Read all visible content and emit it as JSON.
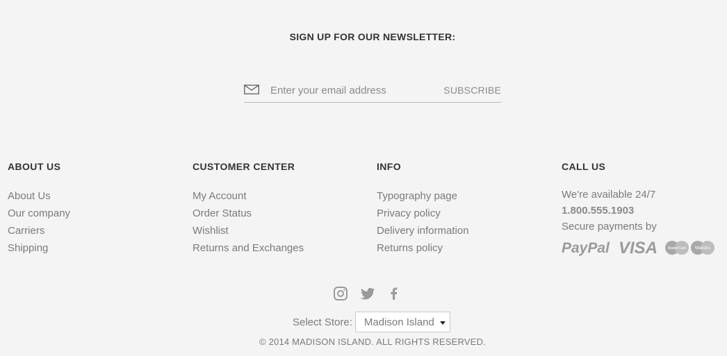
{
  "newsletter": {
    "title": "SIGN UP FOR OUR NEWSLETTER:",
    "email_placeholder": "Enter your email address",
    "subscribe_label": "SUBSCRIBE",
    "icon": "mail-icon"
  },
  "columns": {
    "about": {
      "heading": "ABOUT US",
      "links": [
        "About Us",
        "Our company",
        "Carriers",
        "Shipping"
      ]
    },
    "customer": {
      "heading": "CUSTOMER CENTER",
      "links": [
        "My Account",
        "Order Status",
        "Wishlist",
        "Returns and Exchanges"
      ]
    },
    "info": {
      "heading": "INFO",
      "links": [
        "Typography page",
        "Privacy policy",
        "Delivery information",
        "Returns policy"
      ]
    },
    "call": {
      "heading": "CALL US",
      "availability": "We're available 24/7",
      "phone": "1.800.555.1903",
      "payments_label": "Secure payments by",
      "payment_methods": [
        "PayPal",
        "VISA",
        "MasterCard",
        "Maestro"
      ]
    }
  },
  "social": [
    "instagram-icon",
    "twitter-icon",
    "facebook-icon"
  ],
  "store": {
    "label": "Select Store:",
    "selected": "Madison Island"
  },
  "copyright": "© 2014 MADISON ISLAND. ALL RIGHTS RESERVED.",
  "colors": {
    "background": "#f4f4f4",
    "heading": "#333333",
    "text": "#7a7a7a",
    "icon": "#9a9a9a"
  }
}
